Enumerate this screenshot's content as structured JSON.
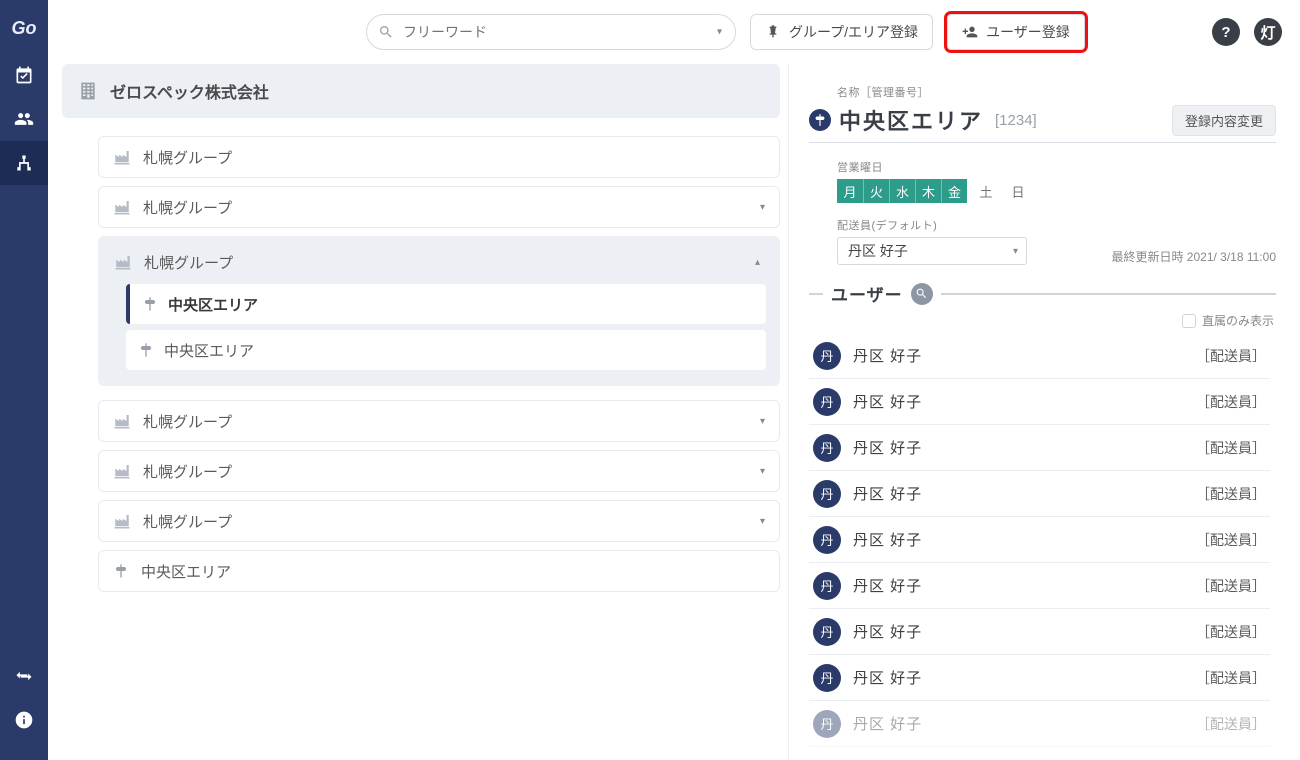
{
  "brand": "Go",
  "topbar": {
    "search_placeholder": "フリーワード",
    "group_area_btn": "グループ/エリア登録",
    "user_reg_btn": "ユーザー登録",
    "help_label": "?",
    "lamp_label": "灯"
  },
  "company": {
    "name": "ゼロスペック株式会社"
  },
  "tree": {
    "group_label": "札幌グループ",
    "area_label": "中央区エリア",
    "rows": [
      {
        "type": "group",
        "label": "札幌グループ",
        "collapsed": true,
        "caret": ""
      },
      {
        "type": "group",
        "label": "札幌グループ",
        "collapsed": true,
        "caret": "▾"
      },
      {
        "type": "group-expanded",
        "label": "札幌グループ",
        "areas": [
          {
            "label": "中央区エリア",
            "active": true
          },
          {
            "label": "中央区エリア",
            "active": false
          }
        ]
      },
      {
        "type": "group",
        "label": "札幌グループ",
        "collapsed": true,
        "caret": "▾"
      },
      {
        "type": "group",
        "label": "札幌グループ",
        "collapsed": true,
        "caret": "▾"
      },
      {
        "type": "group",
        "label": "札幌グループ",
        "collapsed": true,
        "caret": "▾"
      },
      {
        "type": "area",
        "label": "中央区エリア"
      }
    ]
  },
  "detail": {
    "name_field_label": "名称［管理番号］",
    "title": "中央区エリア",
    "code": "[1234]",
    "change_btn": "登録内容変更",
    "days_label": "営業曜日",
    "days_on": [
      "月",
      "火",
      "水",
      "木",
      "金"
    ],
    "days_off": [
      "土",
      "日"
    ],
    "driver_label": "配送員(デフォルト)",
    "driver_value": "丹区 好子",
    "last_updated_label": "最終更新日時",
    "last_updated_value": "2021/ 3/18 11:00",
    "users_heading": "ユーザー",
    "direct_only_label": "直属のみ表示",
    "avatar_char": "丹",
    "role_label": "［配送員］",
    "users": [
      {
        "name": "丹区 好子",
        "role": "［配送員］"
      },
      {
        "name": "丹区 好子",
        "role": "［配送員］"
      },
      {
        "name": "丹区 好子",
        "role": "［配送員］"
      },
      {
        "name": "丹区 好子",
        "role": "［配送員］"
      },
      {
        "name": "丹区 好子",
        "role": "［配送員］"
      },
      {
        "name": "丹区 好子",
        "role": "［配送員］"
      },
      {
        "name": "丹区 好子",
        "role": "［配送員］"
      },
      {
        "name": "丹区 好子",
        "role": "［配送員］"
      },
      {
        "name": "丹区 好子",
        "role": "［配送員］",
        "faded": true
      }
    ]
  }
}
